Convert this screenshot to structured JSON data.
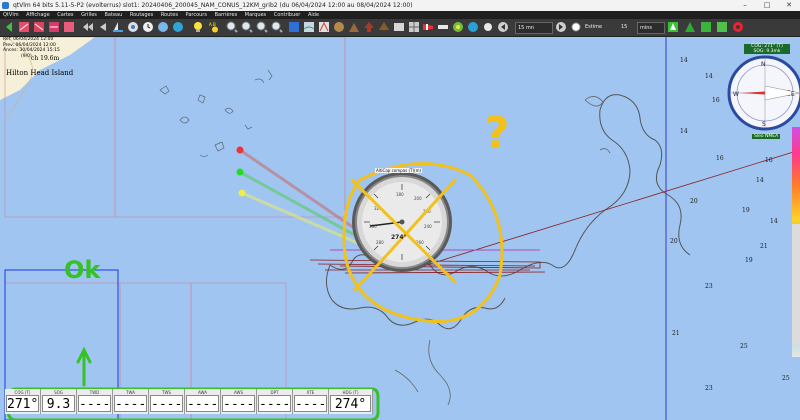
{
  "window": {
    "title": "qtVlm 64 bits 5.11-5-P2 (evolterrus) slot1: 20240406_200045_NAM_CONUS_12KM_grib2 (du 06/04/2024 12:00 au 08/04/2024 12:00)",
    "controls": [
      "–",
      "□",
      "✕"
    ]
  },
  "menu": [
    "QtVlm",
    "Affichage",
    "Cartes",
    "Grilles",
    "Bateau",
    "Routages",
    "Routes",
    "Parcours",
    "Barrières",
    "Marques",
    "Contribuer",
    "Aide"
  ],
  "toolbar": {
    "step": "15 mn",
    "mode": "Estime",
    "value": "15",
    "unit": "mins",
    "sun_label": "A.B"
  },
  "map_info": {
    "line1": "Ref: 06/04/2024 12:00",
    "line2": "Prev: 06/04/2024 12:00",
    "line3": "Ances: 30/04/2024 15:15",
    "line4": "(9/0)",
    "measure": "ch 19.6m",
    "island": "Hilton Head Island"
  },
  "compass": {
    "cog_line": "COG: 271° (T)",
    "sog_line": "SOG: 9.3mk",
    "nmea_badge": "Sleo NMEA",
    "labels": [
      "N",
      "E",
      "S",
      "W"
    ]
  },
  "gauge": {
    "title": "AltiCap compas (T)(m)",
    "readout": "274°",
    "ticks": [
      "180",
      "200",
      "220",
      "240",
      "260",
      "280",
      "300",
      "320"
    ]
  },
  "depths": [
    "14",
    "14",
    "16",
    "14",
    "16",
    "16",
    "14",
    "20",
    "19",
    "14",
    "20",
    "23",
    "19",
    "21",
    "25",
    "23",
    "21",
    "25",
    "14",
    "14",
    "14",
    "23"
  ],
  "annotations": {
    "ok": "Ok",
    "question": "?"
  },
  "dashboard": {
    "cells": [
      {
        "header": "COG (T)",
        "value": "271°"
      },
      {
        "header": "SOG",
        "value": "9.3"
      },
      {
        "header": "TWD",
        "value": "----"
      },
      {
        "header": "TWA",
        "value": "----"
      },
      {
        "header": "TWS",
        "value": "----"
      },
      {
        "header": "AWA",
        "value": "----"
      },
      {
        "header": "AWS",
        "value": "----"
      },
      {
        "header": "DPT",
        "value": "----"
      },
      {
        "header": "XTE",
        "value": "----"
      },
      {
        "header": "HDG (T)",
        "value": "274°"
      }
    ]
  },
  "colors": {
    "sea": "#9fc5f0",
    "land": "#f6f0d8",
    "highlight_green": "#36c226",
    "highlight_yellow": "#f2c21a",
    "route_red": "#8b1a1a"
  }
}
